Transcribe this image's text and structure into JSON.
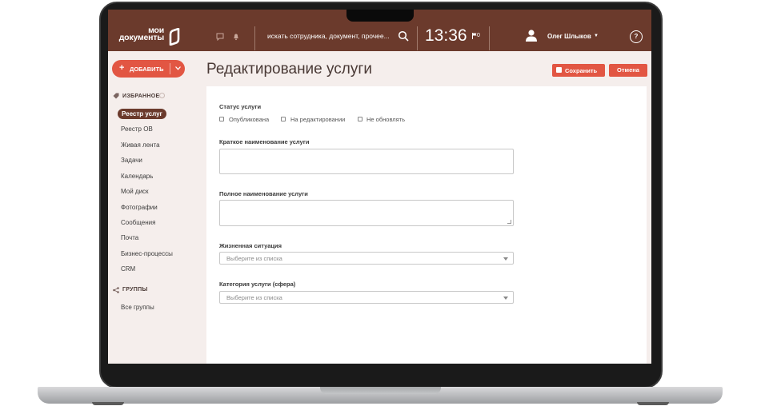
{
  "header": {
    "logo_text_line1": "мои",
    "logo_text_line2": "документы",
    "search_placeholder": "искать сотрудника, документ, прочее...",
    "clock": "13:36",
    "flag_count": "0",
    "user_name": "Олег Шлыков",
    "help_label": "?"
  },
  "sidebar": {
    "add_button": "ДОБАВИТЬ",
    "favorites_title": "ИЗБРАННОЕ",
    "items": [
      {
        "label": "Реестр услуг"
      },
      {
        "label": "Реестр ОВ"
      },
      {
        "label": "Живая лента"
      },
      {
        "label": "Задачи"
      },
      {
        "label": "Календарь"
      },
      {
        "label": "Мой диск"
      },
      {
        "label": "Фотографии"
      },
      {
        "label": "Сообщения"
      },
      {
        "label": "Почта"
      },
      {
        "label": "Бизнес-процессы"
      },
      {
        "label": "CRM"
      }
    ],
    "groups_title": "ГРУППЫ",
    "groups_item": "Все группы"
  },
  "main": {
    "page_title": "Редактирование услуги",
    "save_button": "Сохранить",
    "cancel_button": "Отмена",
    "status_label": "Статус услуги",
    "status_options": [
      "Опубликована",
      "На редактировании",
      "Не обновлять"
    ],
    "short_name_label": "Краткое наименование услуги",
    "full_name_label": "Полное наименование услуги",
    "life_situation_label": "Жизненная ситуация",
    "life_situation_placeholder": "Выберите из списка",
    "category_label": "Категория услуги (сфера)",
    "category_placeholder": "Выберите из списка"
  },
  "colors": {
    "header_bg": "#6b3a2c",
    "accent": "#e25643",
    "sidebar_bg": "#f5eeec"
  }
}
